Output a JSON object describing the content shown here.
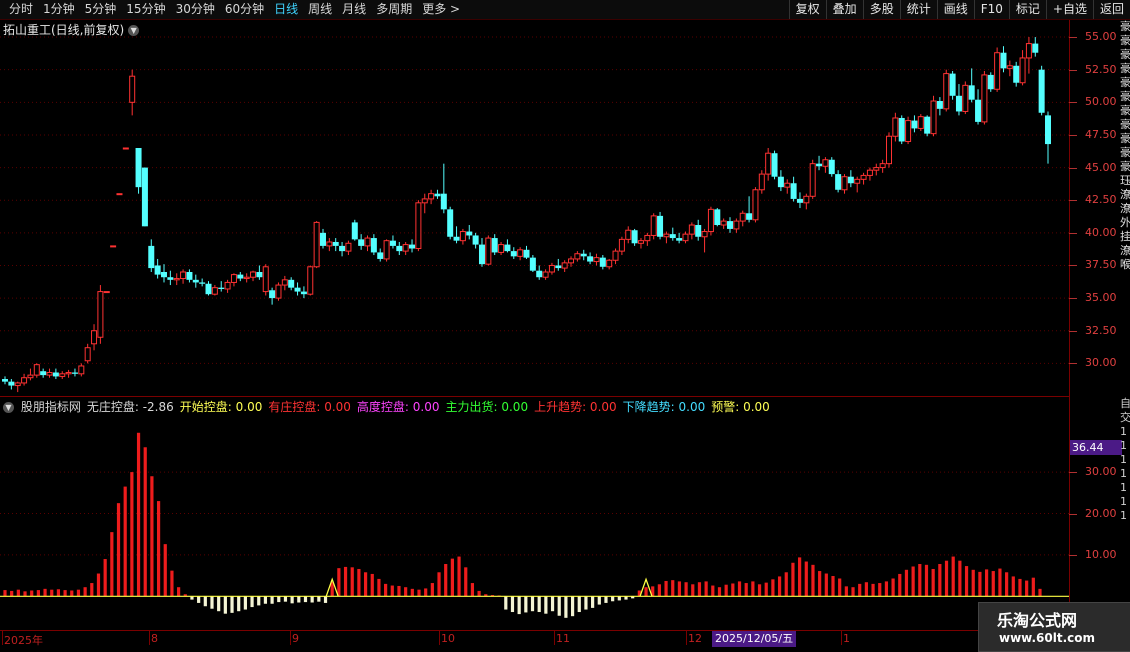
{
  "toolbar": {
    "left": [
      "分时",
      "1分钟",
      "5分钟",
      "15分钟",
      "30分钟",
      "60分钟",
      "日线",
      "周线",
      "月线",
      "多周期",
      "更多 >"
    ],
    "active_index": 6,
    "right": [
      "复权",
      "叠加",
      "多股",
      "统计",
      "画线",
      "F10",
      "标记",
      "+自选",
      "返回"
    ]
  },
  "main_title": "拓山重工(日线,前复权)",
  "price_axis": [
    "55.00",
    "52.50",
    "50.00",
    "47.50",
    "45.00",
    "42.50",
    "40.00",
    "37.50",
    "35.00",
    "32.50",
    "30.00"
  ],
  "indicator": {
    "items": [
      {
        "text": "股朋指标网",
        "color": "#d8d8d8"
      },
      {
        "text": "无庄控盘: -2.86",
        "color": "#d8d8d8"
      },
      {
        "text": "开始控盘: 0.00",
        "color": "#ffff55"
      },
      {
        "text": "有庄控盘: 0.00",
        "color": "#ff3333"
      },
      {
        "text": "高度控盘: 0.00",
        "color": "#ff44ff"
      },
      {
        "text": "主力出货: 0.00",
        "color": "#33ff33"
      },
      {
        "text": "上升趋势: 0.00",
        "color": "#ff3333"
      },
      {
        "text": "下降趋势: 0.00",
        "color": "#44ddff"
      },
      {
        "text": "预警: 0.00",
        "color": "#ffff55"
      }
    ],
    "axis": [
      "30.00",
      "20.00",
      "10.00"
    ],
    "current_value": "36.44"
  },
  "timeline": {
    "labels": [
      "2025年",
      "8",
      "9",
      "10",
      "11",
      "12",
      "1"
    ],
    "date_badge": "2025/12/05/五"
  },
  "edge_text": "豪豪豪豪豪豪豪豪豪豪豪珏潦潦外挂潦喉",
  "edge_text_lower": "自交1111111",
  "watermark": {
    "line1": "乐淘公式网",
    "line2": "www.60lt.com"
  },
  "chart_data": {
    "type": "candlestick",
    "price_range": [
      27.5,
      56.0
    ],
    "candles": [
      [
        28.8,
        29.0,
        28.4,
        28.6
      ],
      [
        28.6,
        28.8,
        28.0,
        28.3
      ],
      [
        28.3,
        28.6,
        27.8,
        28.5
      ],
      [
        28.5,
        29.2,
        28.3,
        28.9
      ],
      [
        28.9,
        29.6,
        28.7,
        29.1
      ],
      [
        29.1,
        30.0,
        28.9,
        29.9
      ],
      [
        29.4,
        29.6,
        28.9,
        29.1
      ],
      [
        29.1,
        29.6,
        28.9,
        29.3
      ],
      [
        29.3,
        29.6,
        28.8,
        29.0
      ],
      [
        29.0,
        29.4,
        28.8,
        29.2
      ],
      [
        29.2,
        29.5,
        28.9,
        29.3
      ],
      [
        29.3,
        29.6,
        29.0,
        29.2
      ],
      [
        29.2,
        30.0,
        29.0,
        29.8
      ],
      [
        30.2,
        31.5,
        30.0,
        31.2
      ],
      [
        31.5,
        33.0,
        31.0,
        32.5
      ],
      [
        32.0,
        36.0,
        31.5,
        35.5
      ],
      [
        35.5,
        35.5,
        35.5,
        35.5
      ],
      [
        39.0,
        39.0,
        39.0,
        39.0
      ],
      [
        43.0,
        43.0,
        43.0,
        43.0
      ],
      [
        46.5,
        46.5,
        46.5,
        46.5
      ],
      [
        50.0,
        52.5,
        49.0,
        52.0
      ],
      [
        46.5,
        46.5,
        43.0,
        43.5
      ],
      [
        45.0,
        45.0,
        40.5,
        40.5
      ],
      [
        39.0,
        39.5,
        37.0,
        37.3
      ],
      [
        37.5,
        38.0,
        36.5,
        36.8
      ],
      [
        37.0,
        37.6,
        36.2,
        36.6
      ],
      [
        36.6,
        37.1,
        36.0,
        36.4
      ],
      [
        36.4,
        36.9,
        36.0,
        36.5
      ],
      [
        36.5,
        37.2,
        36.1,
        37.0
      ],
      [
        37.0,
        37.2,
        36.2,
        36.4
      ],
      [
        36.4,
        36.8,
        35.8,
        36.2
      ],
      [
        36.2,
        36.5,
        35.9,
        36.1
      ],
      [
        36.1,
        36.3,
        35.2,
        35.3
      ],
      [
        35.3,
        36.0,
        35.2,
        35.8
      ],
      [
        35.8,
        36.3,
        35.5,
        35.7
      ],
      [
        35.7,
        36.4,
        35.4,
        36.2
      ],
      [
        36.2,
        36.9,
        35.9,
        36.8
      ],
      [
        36.8,
        37.0,
        36.3,
        36.5
      ],
      [
        36.5,
        36.9,
        36.2,
        36.6
      ],
      [
        36.6,
        37.1,
        36.3,
        37.0
      ],
      [
        37.0,
        37.5,
        36.4,
        36.6
      ],
      [
        35.5,
        37.6,
        35.2,
        37.4
      ],
      [
        35.6,
        35.8,
        34.5,
        35.0
      ],
      [
        35.0,
        36.2,
        34.8,
        36.0
      ],
      [
        36.0,
        36.7,
        35.6,
        36.4
      ],
      [
        36.4,
        36.6,
        35.6,
        35.8
      ],
      [
        35.8,
        36.2,
        35.2,
        35.5
      ],
      [
        35.5,
        35.9,
        35.0,
        35.3
      ],
      [
        35.3,
        37.5,
        35.2,
        37.4
      ],
      [
        37.4,
        40.9,
        37.3,
        40.8
      ],
      [
        40.0,
        40.3,
        38.8,
        39.0
      ],
      [
        39.0,
        39.6,
        38.6,
        39.3
      ],
      [
        39.3,
        39.6,
        38.6,
        39.0
      ],
      [
        39.0,
        39.3,
        38.2,
        38.6
      ],
      [
        38.6,
        39.4,
        38.3,
        39.2
      ],
      [
        40.8,
        41.0,
        39.4,
        39.5
      ],
      [
        39.5,
        39.9,
        38.7,
        39.0
      ],
      [
        39.0,
        39.8,
        38.6,
        39.6
      ],
      [
        39.6,
        39.9,
        38.3,
        38.5
      ],
      [
        38.5,
        38.8,
        37.8,
        38.0
      ],
      [
        38.0,
        39.5,
        37.8,
        39.4
      ],
      [
        39.4,
        39.8,
        38.8,
        39.0
      ],
      [
        39.0,
        39.3,
        38.3,
        38.6
      ],
      [
        38.6,
        39.3,
        38.3,
        39.1
      ],
      [
        39.1,
        39.5,
        38.5,
        38.8
      ],
      [
        38.8,
        42.5,
        38.6,
        42.3
      ],
      [
        42.3,
        43.0,
        41.5,
        42.6
      ],
      [
        42.6,
        43.3,
        42.2,
        43.0
      ],
      [
        43.0,
        43.3,
        42.6,
        42.8
      ],
      [
        43.0,
        45.3,
        41.5,
        41.8
      ],
      [
        41.8,
        42.0,
        39.5,
        39.7
      ],
      [
        39.7,
        40.5,
        39.2,
        39.4
      ],
      [
        39.4,
        40.3,
        39.1,
        40.1
      ],
      [
        40.1,
        40.6,
        39.5,
        39.8
      ],
      [
        39.8,
        40.0,
        38.8,
        39.1
      ],
      [
        39.1,
        39.6,
        37.4,
        37.6
      ],
      [
        37.6,
        39.8,
        37.5,
        39.6
      ],
      [
        39.6,
        39.9,
        38.3,
        38.5
      ],
      [
        38.5,
        39.3,
        38.3,
        39.1
      ],
      [
        39.1,
        39.5,
        38.5,
        38.6
      ],
      [
        38.6,
        38.9,
        38.0,
        38.2
      ],
      [
        38.2,
        38.9,
        37.9,
        38.7
      ],
      [
        38.7,
        39.0,
        38.0,
        38.1
      ],
      [
        38.1,
        38.3,
        37.0,
        37.1
      ],
      [
        37.1,
        37.5,
        36.4,
        36.6
      ],
      [
        36.6,
        37.2,
        36.4,
        37.0
      ],
      [
        37.0,
        37.7,
        36.8,
        37.5
      ],
      [
        37.5,
        38.0,
        37.1,
        37.3
      ],
      [
        37.3,
        37.9,
        37.0,
        37.7
      ],
      [
        37.7,
        38.2,
        37.4,
        38.0
      ],
      [
        38.0,
        38.6,
        37.8,
        38.4
      ],
      [
        38.4,
        38.7,
        37.9,
        38.2
      ],
      [
        38.2,
        38.5,
        37.6,
        37.8
      ],
      [
        37.8,
        38.4,
        37.5,
        38.1
      ],
      [
        38.1,
        38.3,
        37.2,
        37.4
      ],
      [
        37.4,
        38.0,
        37.2,
        37.9
      ],
      [
        37.9,
        38.8,
        37.6,
        38.6
      ],
      [
        38.6,
        39.7,
        38.3,
        39.5
      ],
      [
        39.5,
        40.5,
        39.2,
        40.2
      ],
      [
        40.2,
        40.3,
        39.0,
        39.2
      ],
      [
        39.2,
        39.6,
        38.8,
        39.4
      ],
      [
        39.4,
        40.0,
        39.0,
        39.8
      ],
      [
        39.8,
        41.5,
        39.5,
        41.3
      ],
      [
        41.3,
        41.6,
        39.5,
        39.7
      ],
      [
        39.7,
        40.1,
        39.2,
        39.9
      ],
      [
        39.9,
        40.4,
        39.4,
        39.6
      ],
      [
        39.6,
        40.0,
        39.2,
        39.4
      ],
      [
        39.4,
        40.1,
        39.2,
        39.9
      ],
      [
        39.9,
        40.8,
        39.5,
        40.6
      ],
      [
        40.6,
        41.0,
        39.4,
        39.7
      ],
      [
        39.7,
        40.3,
        38.5,
        40.1
      ],
      [
        40.1,
        42.0,
        39.8,
        41.8
      ],
      [
        41.8,
        41.9,
        40.5,
        40.6
      ],
      [
        40.6,
        41.1,
        40.3,
        40.9
      ],
      [
        40.9,
        41.2,
        40.0,
        40.3
      ],
      [
        40.3,
        41.1,
        40.0,
        40.9
      ],
      [
        40.9,
        41.7,
        40.5,
        41.5
      ],
      [
        41.5,
        42.8,
        40.8,
        41.0
      ],
      [
        41.0,
        43.5,
        40.8,
        43.3
      ],
      [
        43.3,
        44.8,
        43.0,
        44.5
      ],
      [
        44.5,
        46.5,
        44.0,
        46.1
      ],
      [
        46.1,
        46.3,
        44.1,
        44.3
      ],
      [
        44.3,
        44.8,
        43.2,
        43.5
      ],
      [
        43.5,
        44.1,
        43.0,
        43.8
      ],
      [
        43.8,
        44.3,
        42.4,
        42.6
      ],
      [
        42.6,
        43.1,
        41.9,
        42.3
      ],
      [
        42.3,
        43.0,
        41.8,
        42.8
      ],
      [
        42.8,
        45.6,
        42.6,
        45.3
      ],
      [
        45.3,
        45.9,
        44.8,
        45.1
      ],
      [
        45.1,
        45.8,
        44.6,
        45.6
      ],
      [
        45.6,
        45.8,
        44.3,
        44.5
      ],
      [
        44.5,
        44.8,
        43.1,
        43.3
      ],
      [
        43.3,
        44.5,
        43.0,
        44.3
      ],
      [
        44.3,
        44.8,
        43.5,
        43.8
      ],
      [
        43.8,
        44.3,
        43.1,
        44.1
      ],
      [
        44.1,
        44.6,
        43.7,
        44.4
      ],
      [
        44.4,
        45.0,
        44.0,
        44.8
      ],
      [
        44.8,
        45.3,
        44.4,
        45.0
      ],
      [
        45.0,
        45.6,
        44.6,
        45.3
      ],
      [
        45.3,
        47.7,
        45.0,
        47.4
      ],
      [
        47.4,
        49.2,
        47.0,
        48.8
      ],
      [
        48.8,
        49.0,
        46.8,
        47.0
      ],
      [
        47.0,
        48.9,
        46.8,
        48.6
      ],
      [
        48.6,
        49.0,
        47.7,
        48.0
      ],
      [
        48.0,
        49.1,
        47.8,
        48.9
      ],
      [
        48.9,
        49.0,
        47.4,
        47.6
      ],
      [
        47.6,
        50.5,
        47.4,
        50.1
      ],
      [
        50.1,
        50.4,
        49.0,
        49.5
      ],
      [
        49.5,
        52.5,
        49.3,
        52.2
      ],
      [
        52.2,
        52.4,
        50.2,
        50.5
      ],
      [
        50.5,
        51.4,
        49.0,
        49.3
      ],
      [
        49.3,
        51.6,
        49.1,
        51.3
      ],
      [
        51.3,
        52.6,
        50.0,
        50.2
      ],
      [
        50.2,
        51.0,
        48.3,
        48.5
      ],
      [
        48.5,
        52.4,
        48.3,
        52.1
      ],
      [
        52.1,
        52.3,
        50.8,
        51.0
      ],
      [
        51.0,
        54.2,
        50.8,
        53.8
      ],
      [
        53.8,
        54.3,
        52.3,
        52.6
      ],
      [
        52.6,
        53.2,
        52.0,
        52.8
      ],
      [
        52.8,
        53.1,
        51.2,
        51.5
      ],
      [
        51.5,
        54.0,
        51.3,
        53.4
      ],
      [
        53.4,
        55.0,
        52.2,
        54.5
      ],
      [
        54.5,
        55.0,
        53.5,
        53.8
      ],
      [
        52.5,
        52.8,
        49.0,
        49.2
      ],
      [
        49.0,
        49.3,
        45.3,
        46.8
      ]
    ],
    "indicator_bars": [
      1.5,
      1.3,
      1.6,
      1.2,
      1.4,
      1.5,
      1.8,
      1.6,
      1.7,
      1.5,
      1.4,
      1.6,
      2.2,
      3.2,
      5.5,
      9.0,
      15.5,
      22.5,
      26.5,
      30.0,
      39.5,
      36.0,
      29.0,
      23.0,
      12.6,
      6.2,
      2.2,
      0.5,
      -0.8,
      -1.6,
      -2.4,
      -3.0,
      -3.6,
      -4.2,
      -4.0,
      -3.6,
      -3.2,
      -2.6,
      -2.2,
      -1.8,
      -1.8,
      -1.4,
      -1.3,
      -1.7,
      -1.5,
      -1.4,
      -1.5,
      -1.3,
      -1.6,
      3.5,
      6.8,
      7.1,
      7.0,
      6.6,
      5.8,
      5.4,
      4.2,
      3.0,
      2.6,
      2.5,
      2.2,
      1.8,
      1.6,
      1.9,
      3.2,
      5.8,
      7.8,
      9.1,
      9.6,
      7.0,
      3.2,
      1.3,
      0.5,
      0.3,
      0.2,
      -3.2,
      -3.8,
      -4.3,
      -3.9,
      -3.6,
      -3.8,
      -4.2,
      -3.6,
      -4.7,
      -5.2,
      -4.8,
      -3.8,
      -3.2,
      -2.8,
      -2.0,
      -1.6,
      -1.2,
      -1.0,
      -0.8,
      -0.5,
      1.4,
      2.2,
      2.4,
      2.9,
      3.7,
      3.9,
      3.6,
      3.4,
      2.9,
      3.4,
      3.6,
      2.6,
      2.2,
      2.8,
      3.1,
      3.6,
      3.2,
      3.6,
      2.9,
      3.3,
      4.1,
      4.8,
      5.8,
      8.1,
      9.4,
      8.4,
      7.6,
      6.1,
      5.5,
      4.9,
      4.3,
      2.4,
      2.2,
      3.0,
      3.4,
      3.0,
      3.2,
      3.6,
      4.3,
      5.4,
      6.4,
      7.2,
      7.8,
      7.6,
      6.6,
      7.8,
      8.6,
      9.6,
      8.6,
      7.3,
      6.4,
      5.9,
      6.5,
      6.1,
      6.7,
      5.8,
      4.8,
      4.2,
      3.8,
      4.5,
      1.8
    ],
    "indicator_range": [
      -5,
      45
    ],
    "marker_indices": [
      49,
      96
    ]
  }
}
